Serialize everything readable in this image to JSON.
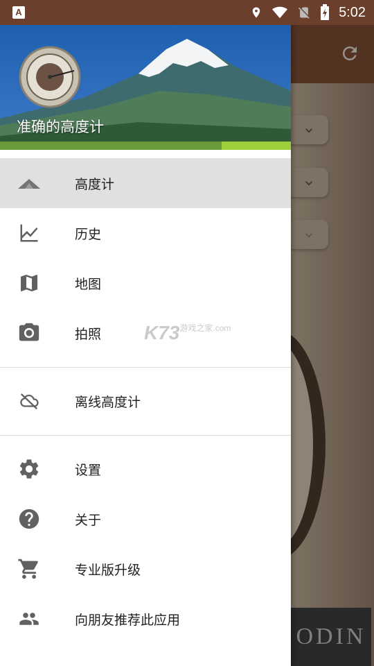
{
  "status_bar": {
    "time": "5:02",
    "left_icon": "A",
    "icons": [
      "location-icon",
      "wifi-icon",
      "no-sim-icon",
      "battery-charging-icon"
    ]
  },
  "drawer": {
    "title": "准确的高度计",
    "items": [
      {
        "label": "高度计",
        "icon": "mountain-icon",
        "selected": true
      },
      {
        "label": "历史",
        "icon": "chart-line-icon"
      },
      {
        "label": "地图",
        "icon": "map-icon"
      },
      {
        "label": "拍照",
        "icon": "camera-icon"
      }
    ],
    "offline_items": [
      {
        "label": "离线高度计",
        "icon": "cloud-off-icon"
      }
    ],
    "other_items": [
      {
        "label": "设置",
        "icon": "gear-icon"
      },
      {
        "label": "关于",
        "icon": "help-icon"
      },
      {
        "label": "专业版升级",
        "icon": "cart-icon"
      },
      {
        "label": "向朋友推荐此应用",
        "icon": "people-icon"
      }
    ]
  },
  "watermark": {
    "brand": "K73",
    "text": "游戏之家",
    "domain": ".com"
  },
  "background": {
    "ad_text": "ODIN"
  },
  "colors": {
    "status_bar": "#6b3f2c",
    "toolbar": "#7a4a31",
    "selected_row": "#e0e0e0"
  }
}
